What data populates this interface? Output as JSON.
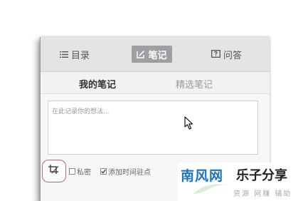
{
  "top_tabs": {
    "catalog": {
      "icon": "list-icon",
      "label": "目录"
    },
    "notes": {
      "icon": "edit-icon",
      "label": "笔记"
    },
    "qa": {
      "icon": "question-icon",
      "label": "问答"
    }
  },
  "sub_tabs": {
    "mine": "我的笔记",
    "featured": "精选笔记"
  },
  "note_input": {
    "placeholder": "在此记录你的想法..."
  },
  "bottom_bar": {
    "screenshot_icon": "screenshot-icon",
    "private_label": "私密",
    "private_checked": false,
    "timestamp_label": "添加时间驻点",
    "timestamp_checked": true
  },
  "watermark": {
    "brand": "南风网",
    "slogan": "乐子分享",
    "sub": "资源 网赚 辅助"
  },
  "colors": {
    "active_tab_bg": "#9d9fa3",
    "highlight_ring": "#c9686b",
    "brand_blue": "#1b73c6"
  }
}
